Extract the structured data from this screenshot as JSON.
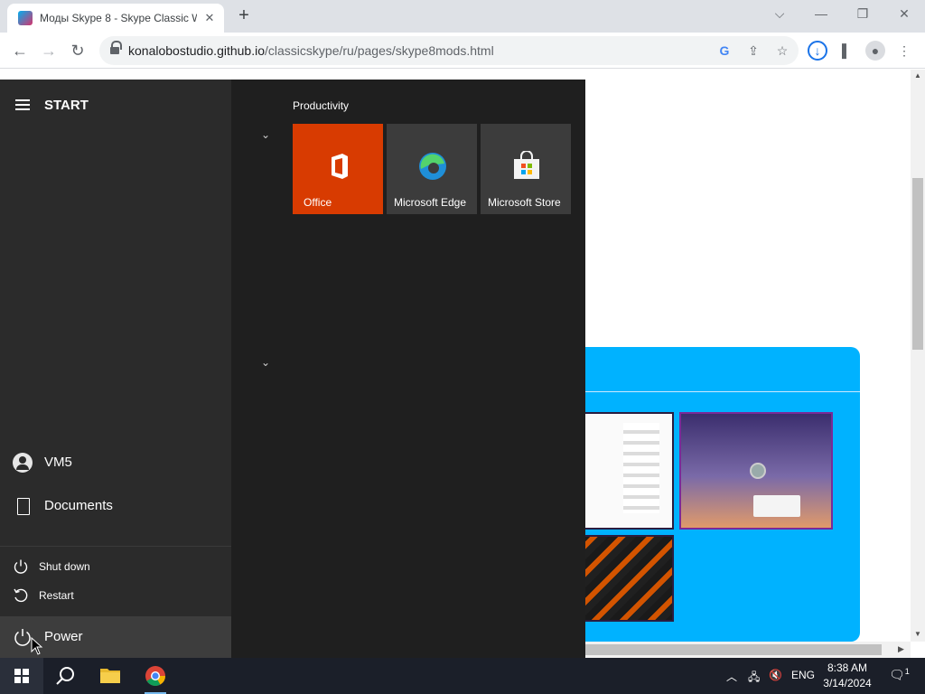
{
  "browser": {
    "tab_title": "Моды Skype 8 - Skype Classic W",
    "url_host": "konalobostudio.github.io",
    "url_path": "/classicskype/ru/pages/skype8mods.html"
  },
  "start_menu": {
    "header_label": "START",
    "group_title": "Productivity",
    "tiles": [
      {
        "label": "Office"
      },
      {
        "label": "Microsoft Edge"
      },
      {
        "label": "Microsoft Store"
      }
    ],
    "user_label": "VM5",
    "documents_label": "Documents",
    "power_options": {
      "shut_down": "Shut down",
      "restart": "Restart"
    },
    "power_label": "Power"
  },
  "taskbar": {
    "language": "ENG",
    "time": "8:38 AM",
    "date": "3/14/2024",
    "notification_count": "1"
  },
  "colors": {
    "office_tile": "#d83b01",
    "page_card": "#00b2ff",
    "start_bg": "#1f1f1f"
  }
}
